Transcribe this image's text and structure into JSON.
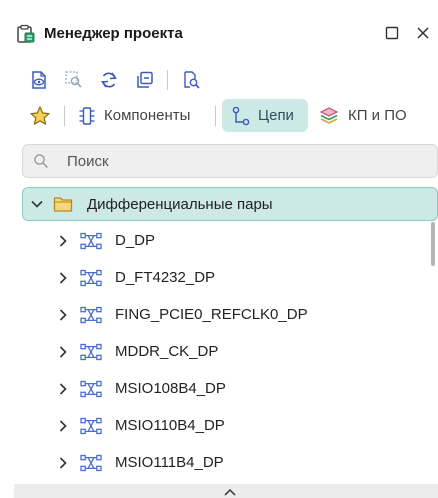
{
  "window": {
    "title": "Менеджер проекта"
  },
  "tabs": [
    {
      "label": "Компоненты",
      "active": false
    },
    {
      "label": "Цепи",
      "active": true
    },
    {
      "label": "КП и ПО",
      "active": false
    }
  ],
  "search": {
    "placeholder": "Поиск",
    "value": ""
  },
  "tree": {
    "group": {
      "label": "Дифференциальные пары",
      "expanded": true
    },
    "items": [
      {
        "label": "D_DP"
      },
      {
        "label": "D_FT4232_DP"
      },
      {
        "label": "FING_PCIE0_REFCLK0_DP"
      },
      {
        "label": "MDDR_CK_DP"
      },
      {
        "label": "MSIO108B4_DP"
      },
      {
        "label": "MSIO110B4_DP"
      },
      {
        "label": "MSIO111B4_DP"
      }
    ]
  },
  "colors": {
    "accent_bg": "#cde9e6",
    "accent_border": "#8fc9c3",
    "net_icon": "#4a6fd0",
    "folder": "#d9b14a",
    "favorite": "#e2b93b"
  }
}
